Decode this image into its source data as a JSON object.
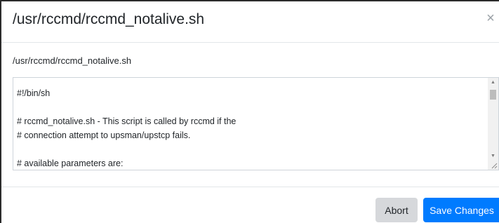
{
  "dialog": {
    "title": "/usr/rccmd/rccmd_notalive.sh",
    "close_symbol": "×"
  },
  "body": {
    "path_label": "/usr/rccmd/rccmd_notalive.sh",
    "script_content": "#!/bin/sh\n\n# rccmd_notalive.sh - This script is called by rccmd if the\n# connection attempt to upsman/upstcp fails.\n\n# available parameters are:"
  },
  "footer": {
    "abort_label": "Abort",
    "save_label": "Save Changes"
  },
  "colors": {
    "primary": "#007bff",
    "secondary": "#d6d8db"
  }
}
